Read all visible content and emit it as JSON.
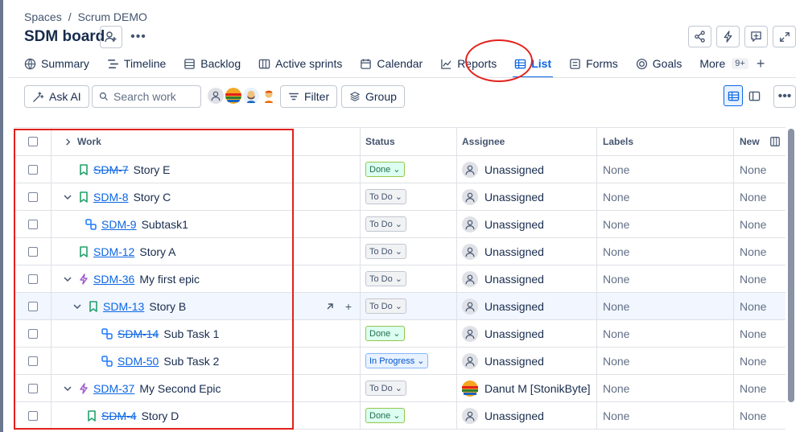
{
  "breadcrumb": {
    "spaces": "Spaces",
    "sep": "/",
    "project": "Scrum DEMO"
  },
  "title": "SDM board",
  "tabs": [
    {
      "label": "Summary",
      "icon": "globe-icon"
    },
    {
      "label": "Timeline",
      "icon": "timeline-icon"
    },
    {
      "label": "Backlog",
      "icon": "backlog-icon"
    },
    {
      "label": "Active sprints",
      "icon": "board-icon"
    },
    {
      "label": "Calendar",
      "icon": "calendar-icon"
    },
    {
      "label": "Reports",
      "icon": "chart-icon"
    },
    {
      "label": "List",
      "icon": "list-icon",
      "active": true
    },
    {
      "label": "Forms",
      "icon": "form-icon"
    },
    {
      "label": "Goals",
      "icon": "target-icon"
    },
    {
      "label": "More",
      "badge": "9+"
    }
  ],
  "toolbar": {
    "ask_ai": "Ask AI",
    "search_placeholder": "Search work",
    "filter": "Filter",
    "group": "Group"
  },
  "columns": {
    "work": "Work",
    "status": "Status",
    "assignee": "Assignee",
    "labels": "Labels",
    "new": "New"
  },
  "rows": [
    {
      "key": "SDM-7",
      "summary": "Story E",
      "status": "Done",
      "assignee": "Unassigned",
      "labels": "None",
      "new": "None"
    },
    {
      "key": "SDM-8",
      "summary": "Story C",
      "status": "To Do",
      "assignee": "Unassigned",
      "labels": "None",
      "new": "None"
    },
    {
      "key": "SDM-9",
      "summary": "Subtask1",
      "status": "To Do",
      "assignee": "Unassigned",
      "labels": "None",
      "new": "None"
    },
    {
      "key": "SDM-12",
      "summary": "Story A",
      "status": "To Do",
      "assignee": "Unassigned",
      "labels": "None",
      "new": "None"
    },
    {
      "key": "SDM-36",
      "summary": "My first epic",
      "status": "To Do",
      "assignee": "Unassigned",
      "labels": "None",
      "new": "None"
    },
    {
      "key": "SDM-13",
      "summary": "Story B",
      "status": "To Do",
      "assignee": "Unassigned",
      "labels": "None",
      "new": "None"
    },
    {
      "key": "SDM-14",
      "summary": "Sub Task 1",
      "status": "Done",
      "assignee": "Unassigned",
      "labels": "None",
      "new": "None"
    },
    {
      "key": "SDM-50",
      "summary": "Sub Task 2",
      "status": "In Progress",
      "assignee": "Unassigned",
      "labels": "None",
      "new": "None"
    },
    {
      "key": "SDM-37",
      "summary": "My Second Epic",
      "status": "To Do",
      "assignee": "Danut M [StonikByte]",
      "labels": "None",
      "new": "None"
    },
    {
      "key": "SDM-4",
      "summary": "Story D",
      "status": "Done",
      "assignee": "Unassigned",
      "labels": "None",
      "new": "None"
    }
  ],
  "colors": {
    "accent": "#0c66e4",
    "highlight": "#e2211c",
    "story": "#22a06b",
    "epic": "#9f5ccf",
    "subtask": "#1d7afc"
  }
}
